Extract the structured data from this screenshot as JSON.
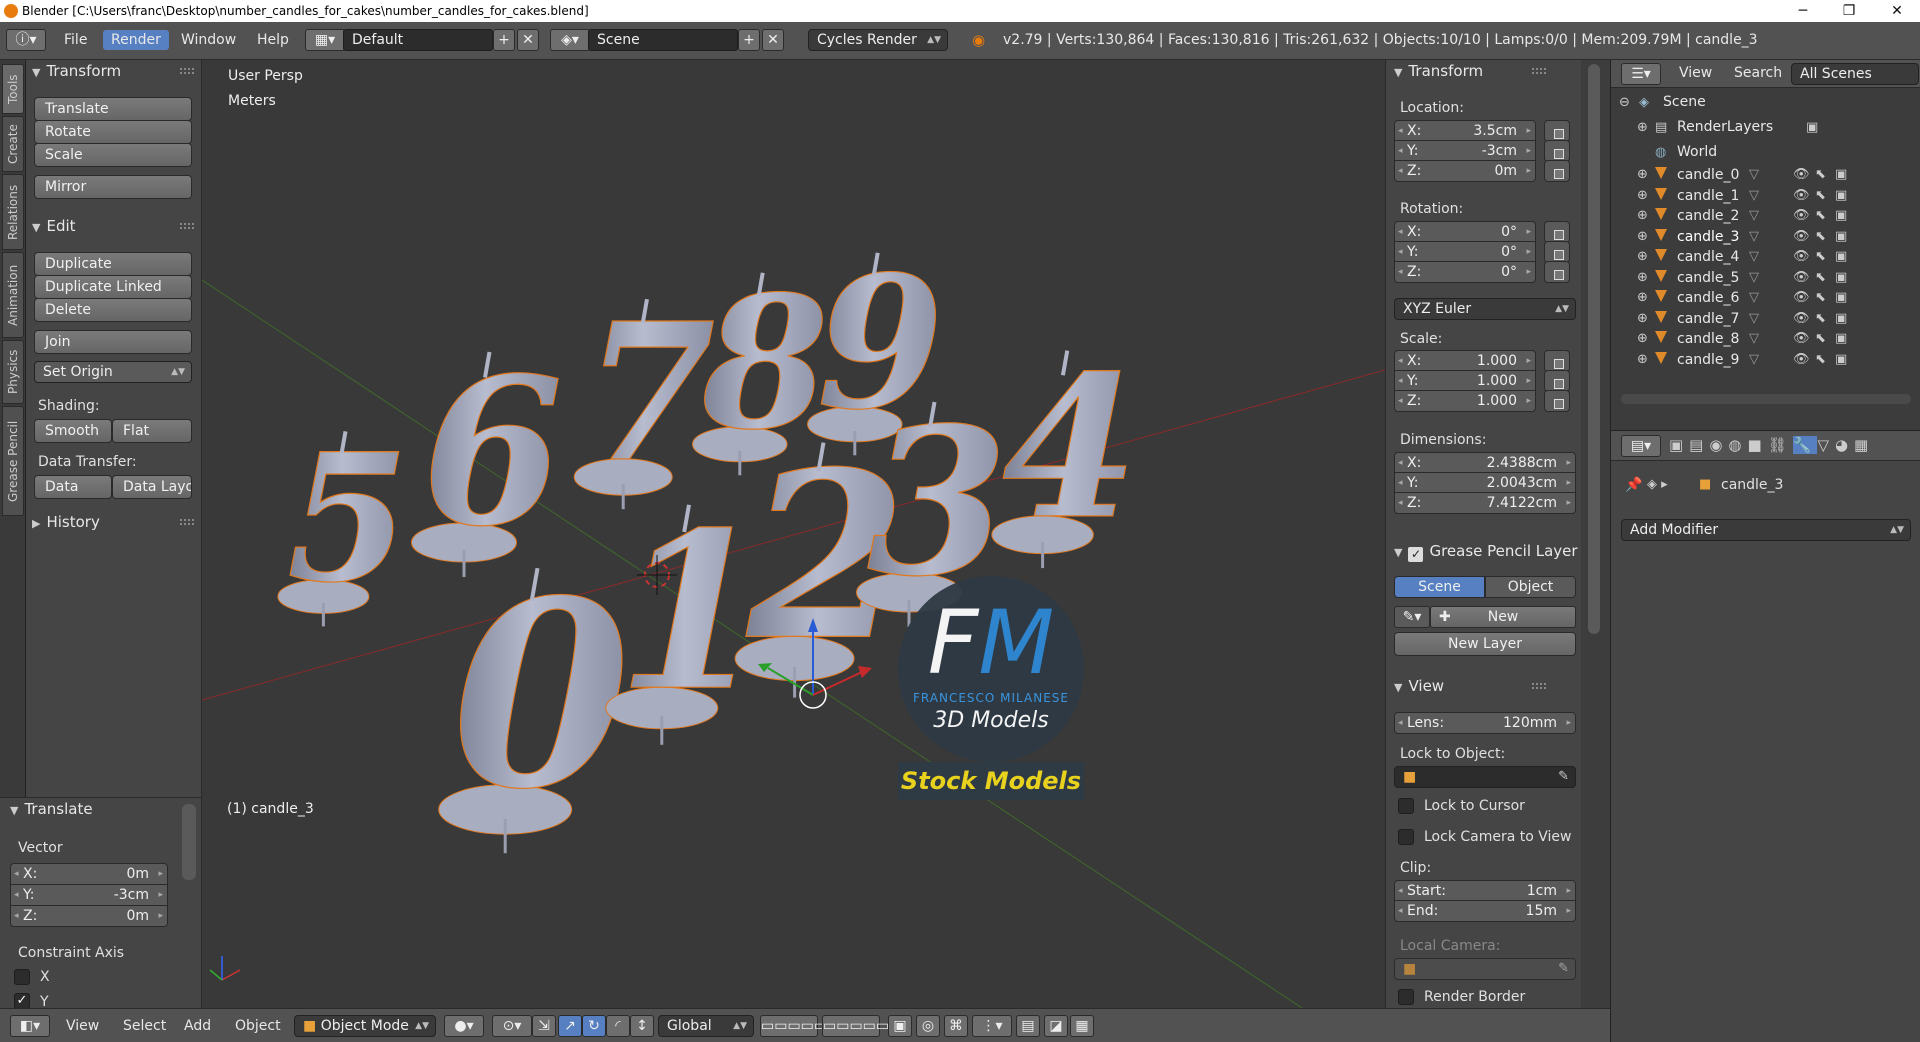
{
  "window": {
    "title": "Blender [C:\\Users\\franc\\Desktop\\number_candles_for_cakes\\number_candles_for_cakes.blend]",
    "minimize": "─",
    "maximize": "❐",
    "close": "✕"
  },
  "infobar": {
    "menus": [
      "File",
      "Render",
      "Window",
      "Help"
    ],
    "layout": "Default",
    "scene": "Scene",
    "engine": "Cycles Render",
    "stats": "v2.79 | Verts:130,864 | Faces:130,816 | Tris:261,632 | Objects:10/10 | Lamps:0/0 | Mem:209.79M | candle_3"
  },
  "tabs": [
    "Tools",
    "Create",
    "Relations",
    "Animation",
    "Physics",
    "Grease Pencil"
  ],
  "toolshelf": {
    "transform": {
      "title": "Transform",
      "buttons": [
        "Translate",
        "Rotate",
        "Scale",
        "Mirror"
      ]
    },
    "edit": {
      "title": "Edit",
      "buttons": [
        "Duplicate",
        "Duplicate Linked",
        "Delete",
        "Join"
      ],
      "set_origin": "Set Origin",
      "shading_label": "Shading:",
      "smooth": "Smooth",
      "flat": "Flat",
      "data_transfer_label": "Data Transfer:",
      "data": "Data",
      "data_layout": "Data Layo"
    },
    "history": "History"
  },
  "operator": {
    "title": "Translate",
    "vector_label": "Vector",
    "x_label": "X:",
    "x": "0m",
    "y_label": "Y:",
    "y": "-3cm",
    "z_label": "Z:",
    "z": "0m",
    "constraint_label": "Constraint Axis",
    "cx": "X",
    "cy": "Y"
  },
  "viewport": {
    "view_name": "User Persp",
    "units": "Meters",
    "object_label": "(1) candle_3",
    "watermark": {
      "logo": "FM",
      "name": "FRANCESCO MILANESE",
      "sub": "3D Models",
      "banner": "Stock Models"
    },
    "candles": [
      "5",
      "6",
      "0",
      "7",
      "1",
      "8",
      "9",
      "2",
      "3",
      "4"
    ]
  },
  "npanel": {
    "transform_title": "Transform",
    "location_label": "Location:",
    "loc": {
      "x": "3.5cm",
      "y": "-3cm",
      "z": "0m"
    },
    "rotation_label": "Rotation:",
    "rot": {
      "x": "0°",
      "y": "0°",
      "z": "0°"
    },
    "rotation_mode": "XYZ Euler",
    "scale_label": "Scale:",
    "scale": {
      "x": "1.000",
      "y": "1.000",
      "z": "1.000"
    },
    "dimensions_label": "Dimensions:",
    "dim": {
      "x": "2.4388cm",
      "y": "2.0043cm",
      "z": "7.4122cm"
    },
    "axis": {
      "x": "X:",
      "y": "Y:",
      "z": "Z:"
    },
    "grease_title": "Grease Pencil Layer",
    "gp_scene": "Scene",
    "gp_object": "Object",
    "gp_new": "New",
    "gp_new_layer": "New Layer",
    "view_title": "View",
    "lens_label": "Lens:",
    "lens": "120mm",
    "lock_obj_label": "Lock to Object:",
    "lock_cursor": "Lock to Cursor",
    "lock_camera": "Lock Camera to View",
    "clip_label": "Clip:",
    "clip_start_label": "Start:",
    "clip_start": "1cm",
    "clip_end_label": "End:",
    "clip_end": "15m",
    "local_camera_label": "Local Camera:",
    "render_border": "Render Border"
  },
  "outliner": {
    "header": {
      "view": "View",
      "search": "Search",
      "filter": "All Scenes"
    },
    "scene": "Scene",
    "renderlayers": "RenderLayers",
    "world": "World",
    "objects": [
      "candle_0",
      "candle_1",
      "candle_2",
      "candle_3",
      "candle_4",
      "candle_5",
      "candle_6",
      "candle_7",
      "candle_8",
      "candle_9"
    ],
    "selected": "candle_3"
  },
  "properties": {
    "object_name": "candle_3",
    "add_modifier": "Add Modifier"
  },
  "bottombar": {
    "menus": [
      "View",
      "Select",
      "Add",
      "Object"
    ],
    "mode": "Object Mode",
    "orientation": "Global"
  },
  "colors": {
    "accent": "#5680c2",
    "object_orange": "#e08a2a",
    "candle_color": "#9fa3b8",
    "outline": "#e0781e"
  }
}
